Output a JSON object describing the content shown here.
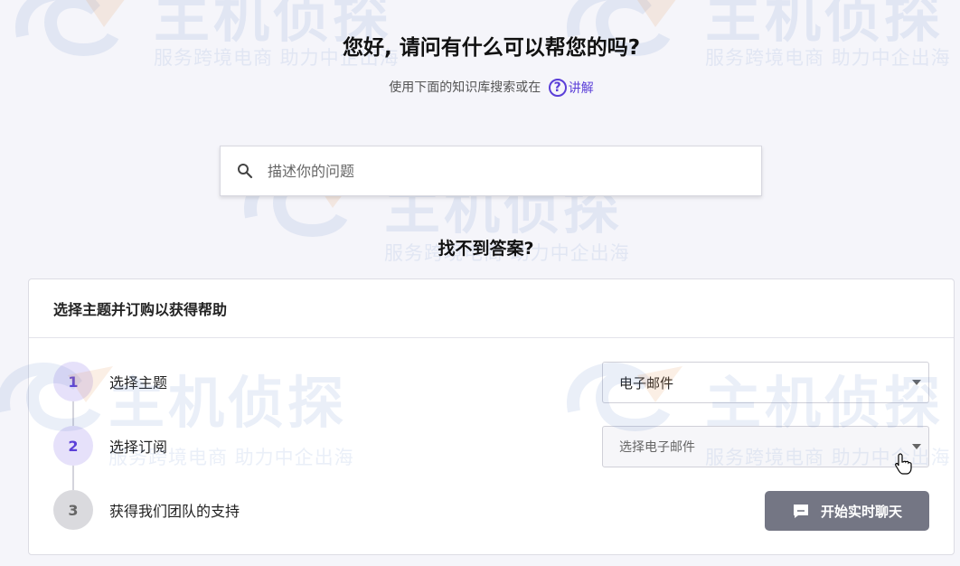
{
  "hero": {
    "title": "您好, 请问有什么可以帮您的吗?",
    "subtitle_prefix": "使用下面的知识库搜索或在",
    "help_link_label": "讲解",
    "help_icon": "question-circle-icon"
  },
  "search": {
    "placeholder": "描述你的问题",
    "value": "",
    "icon": "search-icon"
  },
  "no_answer_heading": "找不到答案?",
  "support_card": {
    "title": "选择主题并订购以获得帮助",
    "steps": [
      {
        "number": "1",
        "label": "选择主题",
        "state": "active"
      },
      {
        "number": "2",
        "label": "选择订阅",
        "state": "active"
      },
      {
        "number": "3",
        "label": "获得我们团队的支持",
        "state": "inactive"
      }
    ],
    "topic_select": {
      "selected": "电子邮件"
    },
    "subscription_select": {
      "selected": "选择电子邮件"
    },
    "chat_button": {
      "label": "开始实时聊天",
      "icon": "chat-bubble-icon"
    }
  },
  "watermark": {
    "brand": "主机侦探",
    "tagline": "服务跨境电商  助力中企出海"
  },
  "colors": {
    "accent": "#5b3fd8",
    "background": "#f5f5fa",
    "chat_button": "#747684"
  }
}
